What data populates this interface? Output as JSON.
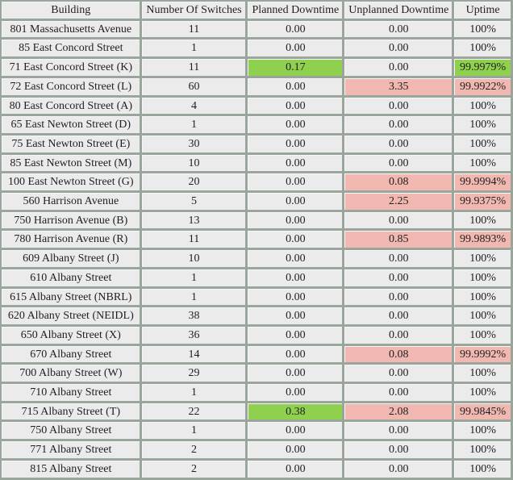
{
  "table": {
    "headers": {
      "building": "Building",
      "switches": "Number Of Switches",
      "planned": "Planned Downtime",
      "unplanned": "Unplanned Downtime",
      "uptime": "Uptime"
    },
    "colors": {
      "border": "#9aa59c",
      "cell": "#ebebeb",
      "planned_highlight": "#8fd14f",
      "unplanned_highlight": "#f0b8b0"
    },
    "rows": [
      {
        "building": "801 Massachusetts Avenue",
        "switches": "11",
        "planned": "0.00",
        "unplanned": "0.00",
        "uptime": "100%"
      },
      {
        "building": "85 East Concord Street",
        "switches": "1",
        "planned": "0.00",
        "unplanned": "0.00",
        "uptime": "100%"
      },
      {
        "building": "71 East Concord Street (K)",
        "switches": "11",
        "planned": "0.17",
        "unplanned": "0.00",
        "uptime": "99.9979%"
      },
      {
        "building": "72 East Concord Street (L)",
        "switches": "60",
        "planned": "0.00",
        "unplanned": "3.35",
        "uptime": "99.9922%"
      },
      {
        "building": "80 East Concord Street (A)",
        "switches": "4",
        "planned": "0.00",
        "unplanned": "0.00",
        "uptime": "100%"
      },
      {
        "building": "65 East Newton Street (D)",
        "switches": "1",
        "planned": "0.00",
        "unplanned": "0.00",
        "uptime": "100%"
      },
      {
        "building": "75 East Newton Street (E)",
        "switches": "30",
        "planned": "0.00",
        "unplanned": "0.00",
        "uptime": "100%"
      },
      {
        "building": "85 East Newton Street (M)",
        "switches": "10",
        "planned": "0.00",
        "unplanned": "0.00",
        "uptime": "100%"
      },
      {
        "building": "100 East Newton Street (G)",
        "switches": "20",
        "planned": "0.00",
        "unplanned": "0.08",
        "uptime": "99.9994%"
      },
      {
        "building": "560 Harrison Avenue",
        "switches": "5",
        "planned": "0.00",
        "unplanned": "2.25",
        "uptime": "99.9375%"
      },
      {
        "building": "750 Harrison Avenue (B)",
        "switches": "13",
        "planned": "0.00",
        "unplanned": "0.00",
        "uptime": "100%"
      },
      {
        "building": "780 Harrison Avenue (R)",
        "switches": "11",
        "planned": "0.00",
        "unplanned": "0.85",
        "uptime": "99.9893%"
      },
      {
        "building": "609 Albany Street (J)",
        "switches": "10",
        "planned": "0.00",
        "unplanned": "0.00",
        "uptime": "100%"
      },
      {
        "building": "610 Albany Street",
        "switches": "1",
        "planned": "0.00",
        "unplanned": "0.00",
        "uptime": "100%"
      },
      {
        "building": "615 Albany Street (NBRL)",
        "switches": "1",
        "planned": "0.00",
        "unplanned": "0.00",
        "uptime": "100%"
      },
      {
        "building": "620 Albany Street (NEIDL)",
        "switches": "38",
        "planned": "0.00",
        "unplanned": "0.00",
        "uptime": "100%"
      },
      {
        "building": "650 Albany Street (X)",
        "switches": "36",
        "planned": "0.00",
        "unplanned": "0.00",
        "uptime": "100%"
      },
      {
        "building": "670 Albany Street",
        "switches": "14",
        "planned": "0.00",
        "unplanned": "0.08",
        "uptime": "99.9992%"
      },
      {
        "building": "700 Albany Street (W)",
        "switches": "29",
        "planned": "0.00",
        "unplanned": "0.00",
        "uptime": "100%"
      },
      {
        "building": "710 Albany Street",
        "switches": "1",
        "planned": "0.00",
        "unplanned": "0.00",
        "uptime": "100%"
      },
      {
        "building": "715 Albany Street (T)",
        "switches": "22",
        "planned": "0.38",
        "unplanned": "2.08",
        "uptime": "99.9845%"
      },
      {
        "building": "750 Albany Street",
        "switches": "1",
        "planned": "0.00",
        "unplanned": "0.00",
        "uptime": "100%"
      },
      {
        "building": "771 Albany Street",
        "switches": "2",
        "planned": "0.00",
        "unplanned": "0.00",
        "uptime": "100%"
      },
      {
        "building": "815 Albany Street",
        "switches": "2",
        "planned": "0.00",
        "unplanned": "0.00",
        "uptime": "100%"
      }
    ]
  }
}
